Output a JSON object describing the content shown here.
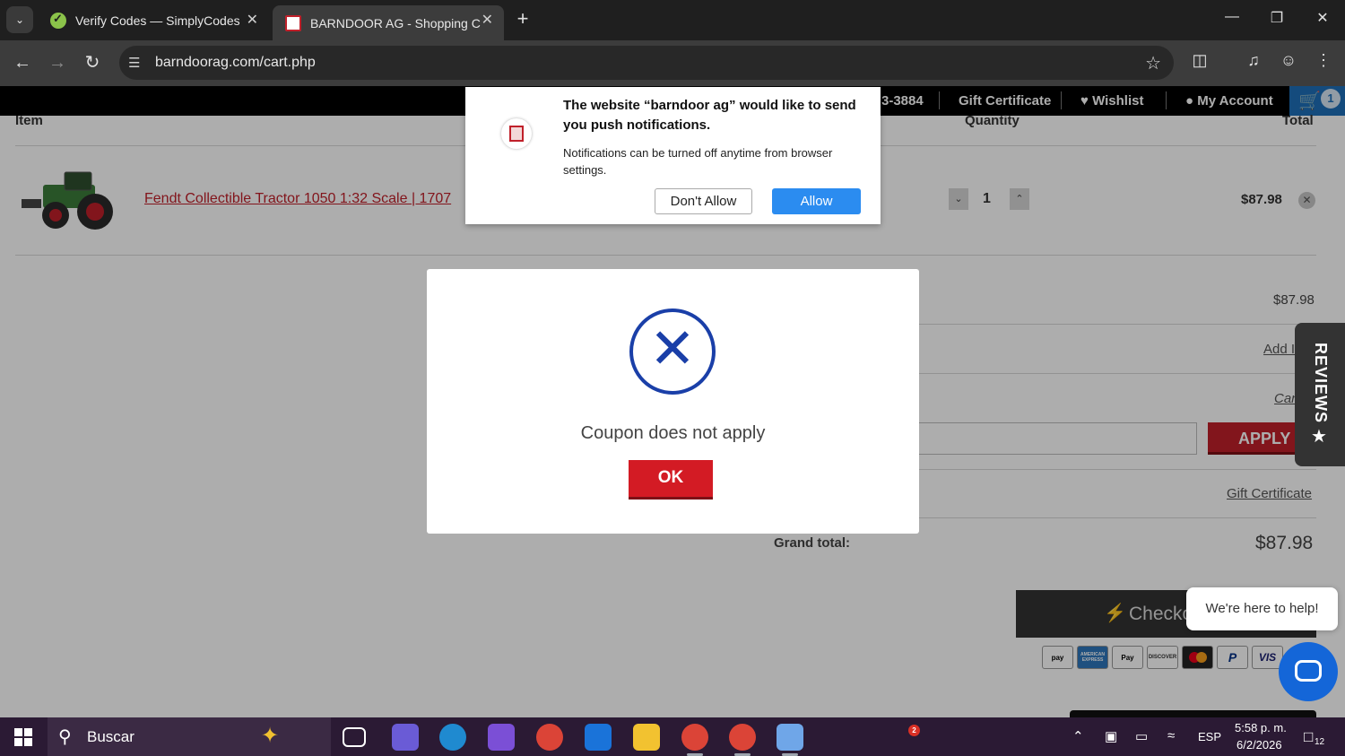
{
  "browser": {
    "tabs": [
      {
        "title": "Verify Codes — SimplyCodes",
        "active": false
      },
      {
        "title": "BARNDOOR AG - Shopping Car",
        "active": true
      }
    ],
    "url": "barndoorag.com/cart.php"
  },
  "site_nav": {
    "phone_fragment": "3-3884",
    "gift_certificate": "Gift Certificate",
    "wishlist": "Wishlist",
    "my_account": "My Account",
    "cart_count": "1"
  },
  "cart": {
    "col_item": "Item",
    "col_quantity": "Quantity",
    "col_total": "Total",
    "product_name": "Fendt Collectible Tractor 1050 1:32 Scale | 1707",
    "quantity": "1",
    "price": "$87.98",
    "subtotal": "$87.98",
    "add_link": "Add I",
    "cancel_link": "Can",
    "apply_label": "APPLY",
    "gift_certificate_link": "Gift Certificate",
    "grand_total_label": "Grand total:",
    "grand_total": "$87.98",
    "checkout_label": "Checko"
  },
  "payment_icons": [
    "pay",
    "AMERICAN EXPRESS",
    "Pay",
    "DISCOVER",
    "mastercard",
    "P",
    "VIS"
  ],
  "reviews_tab": "REVIEWS",
  "help_bubble": "We're here to help!",
  "modal": {
    "message": "Coupon does not apply",
    "ok_label": "OK"
  },
  "push_prompt": {
    "title": "The website “barndoor ag” would like to send you push notifications.",
    "description": "Notifications can be turned off anytime from browser settings.",
    "deny_label": "Don't Allow",
    "allow_label": "Allow"
  },
  "taskbar": {
    "search_placeholder": "Buscar",
    "notification_badge": "2",
    "language": "ESP",
    "time": "5:58 p. m.",
    "date": "6/2/2026",
    "notifications_count": "12"
  },
  "colors": {
    "accent_red": "#c0202a",
    "allow_blue": "#2b8cf0",
    "modal_icon_blue": "#1a3fa8"
  }
}
